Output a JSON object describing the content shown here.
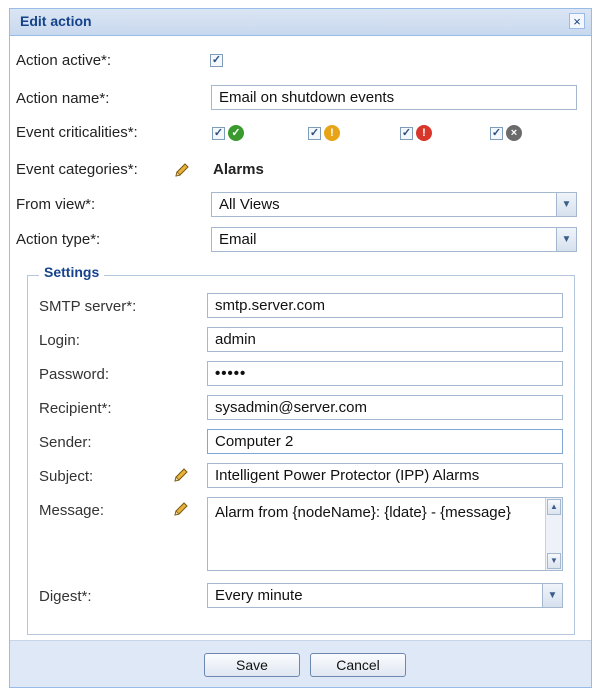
{
  "dialog": {
    "title": "Edit action",
    "close": "×"
  },
  "form": {
    "action_active_label": "Action active*:",
    "action_name_label": "Action name*:",
    "action_name_value": "Email on shutdown events",
    "event_criticalities_label": "Event criticalities*:",
    "event_categories_label": "Event categories*:",
    "event_categories_value": "Alarms",
    "from_view_label": "From view*:",
    "from_view_value": "All Views",
    "action_type_label": "Action type*:",
    "action_type_value": "Email"
  },
  "settings": {
    "legend": "Settings",
    "smtp_label": "SMTP server*:",
    "smtp_value": "smtp.server.com",
    "login_label": "Login:",
    "login_value": "admin",
    "password_label": "Password:",
    "password_value": "•••••",
    "recipient_label": "Recipient*:",
    "recipient_value": "sysadmin@server.com",
    "sender_label": "Sender:",
    "sender_value": "Computer 2",
    "subject_label": "Subject:",
    "subject_value": "Intelligent Power Protector (IPP) Alarms",
    "message_label": "Message:",
    "message_value": "Alarm from {nodeName}: {ldate} - {message}",
    "digest_label": "Digest*:",
    "digest_value": "Every minute"
  },
  "buttons": {
    "save": "Save",
    "cancel": "Cancel"
  },
  "colors": {
    "ok": "#3a9a2e",
    "warning": "#e8a417",
    "critical": "#d9362b",
    "unknown": "#6b6b6b"
  }
}
